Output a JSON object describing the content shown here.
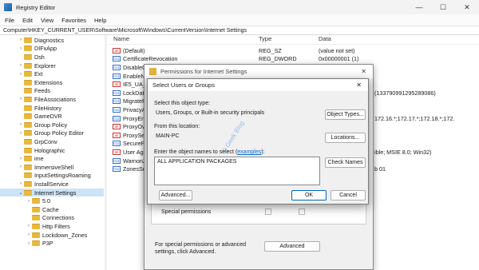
{
  "window": {
    "title": "Registry Editor",
    "controls": {
      "minimize": "—",
      "maximize": "☐",
      "close": "✕"
    }
  },
  "menu": [
    "File",
    "Edit",
    "View",
    "Favorites",
    "Help"
  ],
  "address": "Computer\\HKEY_CURRENT_USER\\Software\\Microsoft\\Windows\\CurrentVersion\\Internet Settings",
  "tree": [
    {
      "label": "Diagnostics",
      "chev": "›"
    },
    {
      "label": "DIFxApp",
      "chev": "›"
    },
    {
      "label": "Dsh",
      "chev": ""
    },
    {
      "label": "Explorer",
      "chev": "›"
    },
    {
      "label": "Ext",
      "chev": "›"
    },
    {
      "label": "Extensions",
      "chev": ""
    },
    {
      "label": "Feeds",
      "chev": ""
    },
    {
      "label": "FileAssociations",
      "chev": "›"
    },
    {
      "label": "FileHistory",
      "chev": ""
    },
    {
      "label": "GameDVR",
      "chev": ""
    },
    {
      "label": "Group Policy",
      "chev": "›"
    },
    {
      "label": "Group Policy Editor",
      "chev": "›"
    },
    {
      "label": "GrpConv",
      "chev": ""
    },
    {
      "label": "Holographic",
      "chev": ""
    },
    {
      "label": "ime",
      "chev": "›"
    },
    {
      "label": "ImmersiveShell",
      "chev": "›"
    },
    {
      "label": "InputSettingsRoaming",
      "chev": ""
    },
    {
      "label": "InstallService",
      "chev": "›"
    },
    {
      "label": "Internet Settings",
      "chev": "⌄",
      "selected": true
    },
    {
      "label": "5.0",
      "chev": "›",
      "indent": 1
    },
    {
      "label": "Cache",
      "chev": "",
      "indent": 1
    },
    {
      "label": "Connections",
      "chev": "",
      "indent": 1
    },
    {
      "label": "Http Filters",
      "chev": "›",
      "indent": 1
    },
    {
      "label": "Lockdown_Zones",
      "chev": "›",
      "indent": 1
    },
    {
      "label": "P3P",
      "chev": "›",
      "indent": 1
    }
  ],
  "list": {
    "headers": {
      "name": "Name",
      "type": "Type",
      "data": "Data"
    },
    "rows": [
      {
        "name": "(Default)",
        "type": "REG_SZ",
        "data": "(value not set)",
        "icon": "ab"
      },
      {
        "name": "CertificateRevocation",
        "type": "REG_DWORD",
        "data": "0x00000001 (1)",
        "icon": "011"
      },
      {
        "name": "DisableCa",
        "type": "",
        "data": "0x00000000 (0)",
        "icon": "011"
      },
      {
        "name": "EnableNe",
        "type": "",
        "data": "0x00000001 (1)",
        "icon": "011"
      },
      {
        "name": "IE5_UA_B",
        "type": "",
        "data": "",
        "icon": "ab"
      },
      {
        "name": "LockData",
        "type": "",
        "data": "(133790991295289086)",
        "icon": "011"
      },
      {
        "name": "MigratePr",
        "type": "",
        "data": "",
        "icon": "011"
      },
      {
        "name": "PrivacyAc",
        "type": "",
        "data": "",
        "icon": "011"
      },
      {
        "name": "ProxyEnal",
        "type": "",
        "data": "172.16.*;172.17.*;172.18.*;172.",
        "icon": "011"
      },
      {
        "name": "ProxyOve",
        "type": "",
        "data": "",
        "icon": "ab"
      },
      {
        "name": "ProxyServ",
        "type": "",
        "data": "",
        "icon": "ab"
      },
      {
        "name": "SecurePro",
        "type": "",
        "data": "",
        "icon": "011"
      },
      {
        "name": "User Agen",
        "type": "",
        "data": "ible; MSIE 8.0; Win32)",
        "icon": "ab"
      },
      {
        "name": "WarnonZo",
        "type": "",
        "data": "",
        "icon": "011"
      },
      {
        "name": "ZonesSec",
        "type": "",
        "data": "b 01",
        "icon": "011"
      }
    ]
  },
  "perm_dialog": {
    "title": "Permissions for Internet Settings",
    "special": "Special permissions",
    "advanced_text": "For special permissions or advanced settings, click Advanced.",
    "advanced_btn": "Advanced"
  },
  "select_dialog": {
    "title": "Select Users or Groups",
    "obj_type_label": "Select this object type:",
    "obj_type_value": "Users, Groups, or Built-in security principals",
    "obj_types_btn": "Object Types...",
    "location_label": "From this location:",
    "location_value": "MAIN-PC",
    "locations_btn": "Locations...",
    "names_label": "Enter the object names to select (",
    "names_link": "examples",
    "names_label_end": "):",
    "names_value": "ALL APPLICATION PACKAGES",
    "check_btn": "Check Names",
    "advanced_btn": "Advanced...",
    "ok_btn": "OK",
    "cancel_btn": "Cancel",
    "watermark": "© Geek Blog"
  }
}
